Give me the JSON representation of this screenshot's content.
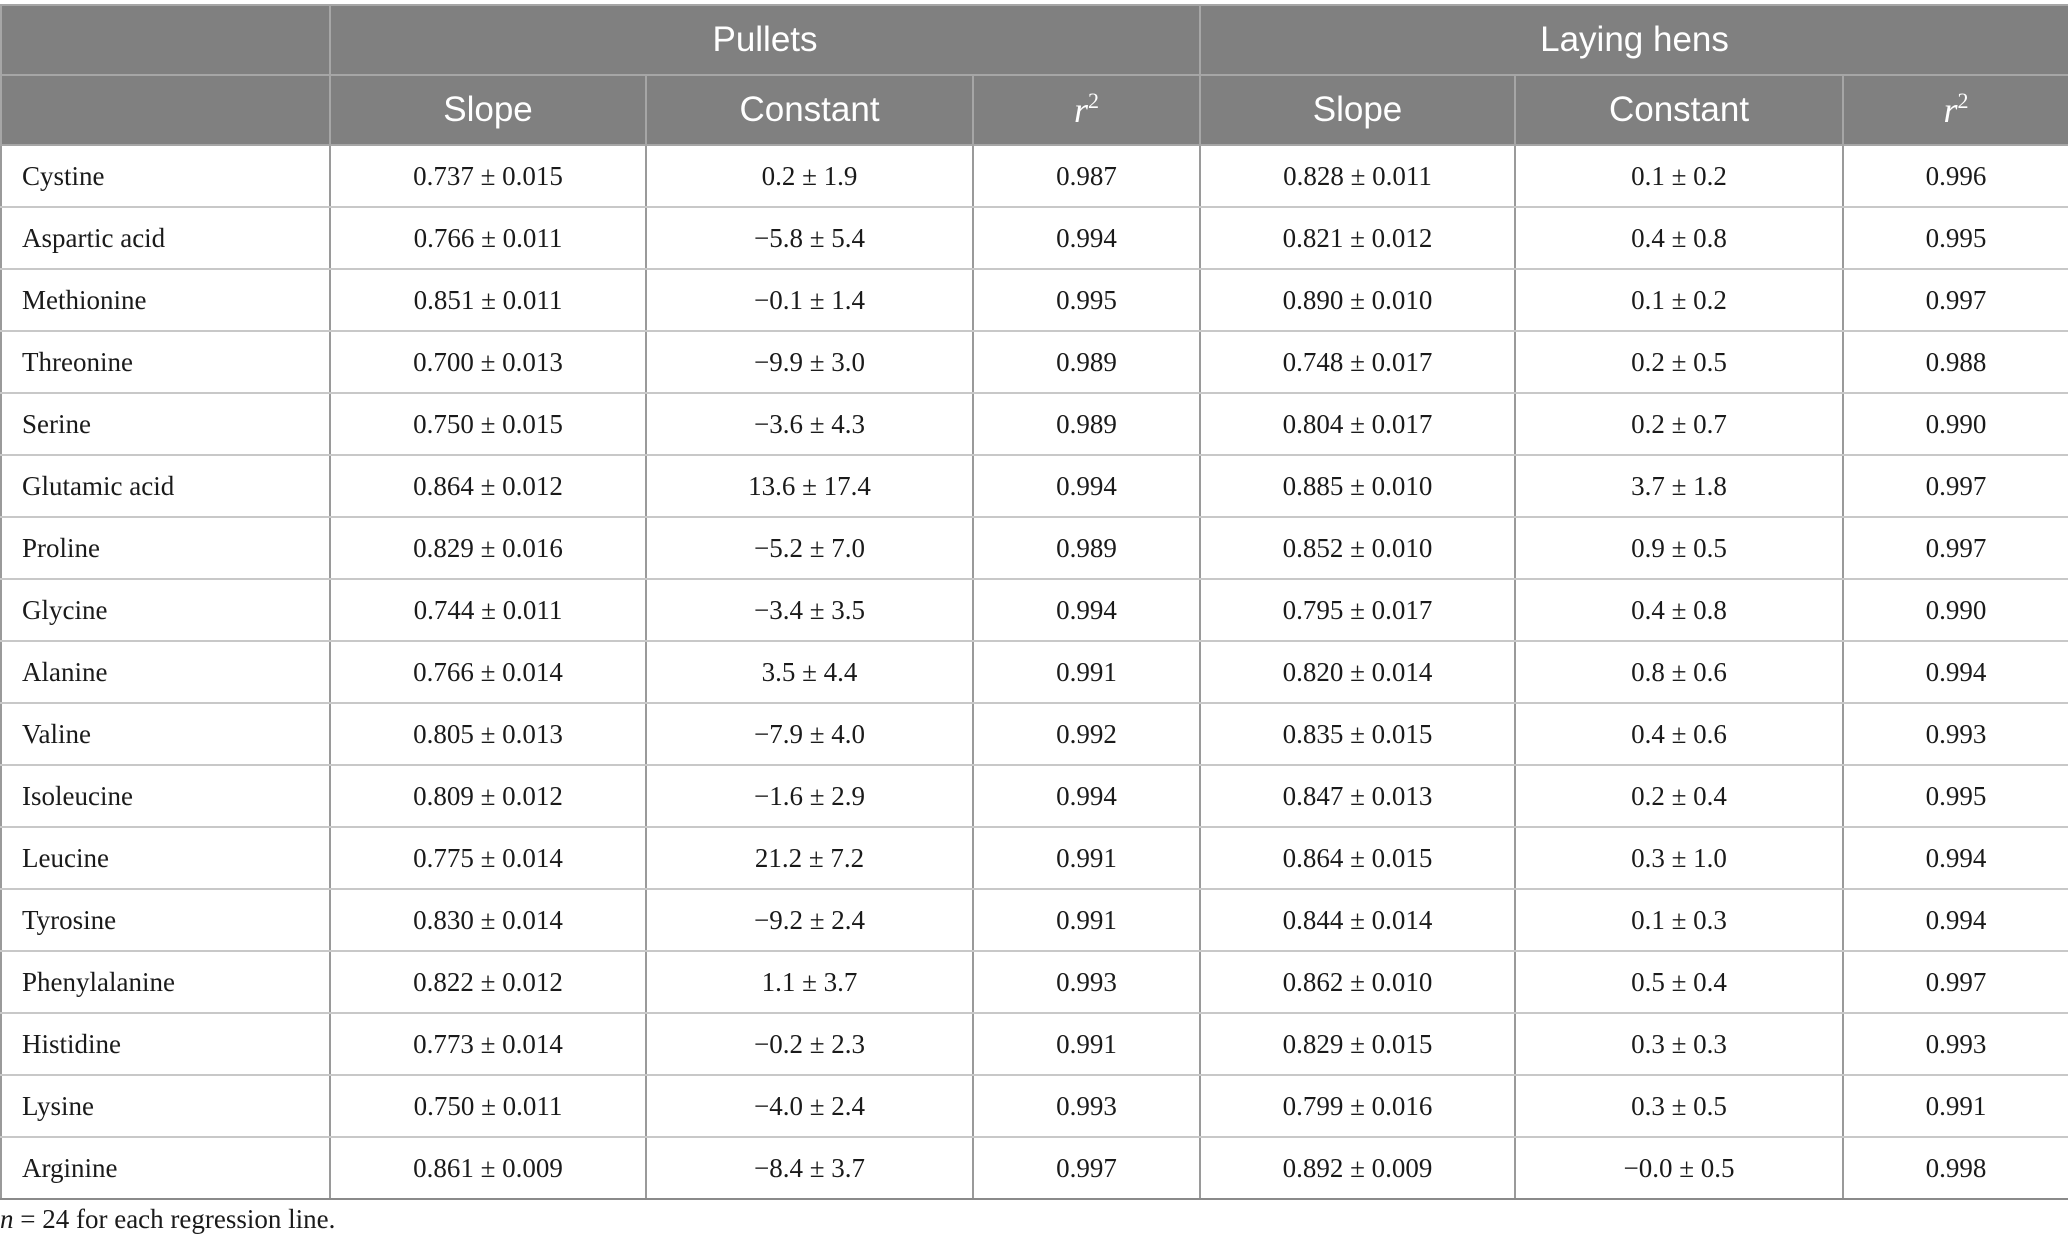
{
  "table": {
    "group_headers": {
      "blank": "",
      "pullets": "Pullets",
      "laying_hens": "Laying hens"
    },
    "sub_headers": {
      "blank": "",
      "slope": "Slope",
      "constant": "Constant",
      "r2_symbol": "r",
      "r2_superscript": "2"
    },
    "rows": [
      {
        "name": "Cystine",
        "p_slope": "0.737 ± 0.015",
        "p_const": "0.2 ± 1.9",
        "p_r2": "0.987",
        "h_slope": "0.828 ± 0.011",
        "h_const": "0.1 ± 0.2",
        "h_r2": "0.996"
      },
      {
        "name": "Aspartic acid",
        "p_slope": "0.766 ± 0.011",
        "p_const": "−5.8 ± 5.4",
        "p_r2": "0.994",
        "h_slope": "0.821 ± 0.012",
        "h_const": "0.4 ± 0.8",
        "h_r2": "0.995"
      },
      {
        "name": "Methionine",
        "p_slope": "0.851 ± 0.011",
        "p_const": "−0.1 ± 1.4",
        "p_r2": "0.995",
        "h_slope": "0.890 ± 0.010",
        "h_const": "0.1 ± 0.2",
        "h_r2": "0.997"
      },
      {
        "name": "Threonine",
        "p_slope": "0.700 ± 0.013",
        "p_const": "−9.9 ± 3.0",
        "p_r2": "0.989",
        "h_slope": "0.748 ± 0.017",
        "h_const": "0.2 ± 0.5",
        "h_r2": "0.988"
      },
      {
        "name": "Serine",
        "p_slope": "0.750 ± 0.015",
        "p_const": "−3.6 ± 4.3",
        "p_r2": "0.989",
        "h_slope": "0.804 ± 0.017",
        "h_const": "0.2 ± 0.7",
        "h_r2": "0.990"
      },
      {
        "name": "Glutamic acid",
        "p_slope": "0.864 ± 0.012",
        "p_const": "13.6 ± 17.4",
        "p_r2": "0.994",
        "h_slope": "0.885 ± 0.010",
        "h_const": "3.7 ± 1.8",
        "h_r2": "0.997"
      },
      {
        "name": "Proline",
        "p_slope": "0.829 ± 0.016",
        "p_const": "−5.2 ± 7.0",
        "p_r2": "0.989",
        "h_slope": "0.852 ± 0.010",
        "h_const": "0.9 ± 0.5",
        "h_r2": "0.997"
      },
      {
        "name": "Glycine",
        "p_slope": "0.744 ± 0.011",
        "p_const": "−3.4 ± 3.5",
        "p_r2": "0.994",
        "h_slope": "0.795 ± 0.017",
        "h_const": "0.4 ± 0.8",
        "h_r2": "0.990"
      },
      {
        "name": "Alanine",
        "p_slope": "0.766 ± 0.014",
        "p_const": "3.5 ± 4.4",
        "p_r2": "0.991",
        "h_slope": "0.820 ± 0.014",
        "h_const": "0.8 ± 0.6",
        "h_r2": "0.994"
      },
      {
        "name": "Valine",
        "p_slope": "0.805 ± 0.013",
        "p_const": "−7.9 ± 4.0",
        "p_r2": "0.992",
        "h_slope": "0.835 ± 0.015",
        "h_const": "0.4 ± 0.6",
        "h_r2": "0.993"
      },
      {
        "name": "Isoleucine",
        "p_slope": "0.809 ± 0.012",
        "p_const": "−1.6 ± 2.9",
        "p_r2": "0.994",
        "h_slope": "0.847 ± 0.013",
        "h_const": "0.2 ± 0.4",
        "h_r2": "0.995"
      },
      {
        "name": "Leucine",
        "p_slope": "0.775 ± 0.014",
        "p_const": "21.2 ± 7.2",
        "p_r2": "0.991",
        "h_slope": "0.864 ± 0.015",
        "h_const": "0.3 ± 1.0",
        "h_r2": "0.994"
      },
      {
        "name": "Tyrosine",
        "p_slope": "0.830 ± 0.014",
        "p_const": "−9.2 ± 2.4",
        "p_r2": "0.991",
        "h_slope": "0.844 ± 0.014",
        "h_const": "0.1 ± 0.3",
        "h_r2": "0.994"
      },
      {
        "name": "Phenylalanine",
        "p_slope": "0.822 ± 0.012",
        "p_const": "1.1 ± 3.7",
        "p_r2": "0.993",
        "h_slope": "0.862 ± 0.010",
        "h_const": "0.5 ± 0.4",
        "h_r2": "0.997"
      },
      {
        "name": "Histidine",
        "p_slope": "0.773 ± 0.014",
        "p_const": "−0.2 ± 2.3",
        "p_r2": "0.991",
        "h_slope": "0.829 ± 0.015",
        "h_const": "0.3 ± 0.3",
        "h_r2": "0.993"
      },
      {
        "name": "Lysine",
        "p_slope": "0.750 ± 0.011",
        "p_const": "−4.0 ± 2.4",
        "p_r2": "0.993",
        "h_slope": "0.799 ± 0.016",
        "h_const": "0.3 ± 0.5",
        "h_r2": "0.991"
      },
      {
        "name": "Arginine",
        "p_slope": "0.861 ± 0.009",
        "p_const": "−8.4 ± 3.7",
        "p_r2": "0.997",
        "h_slope": "0.892 ± 0.009",
        "h_const": "−0.0 ± 0.5",
        "h_r2": "0.998"
      }
    ]
  },
  "footnote": {
    "variable": "n",
    "text": " = 24 for each regression line."
  }
}
